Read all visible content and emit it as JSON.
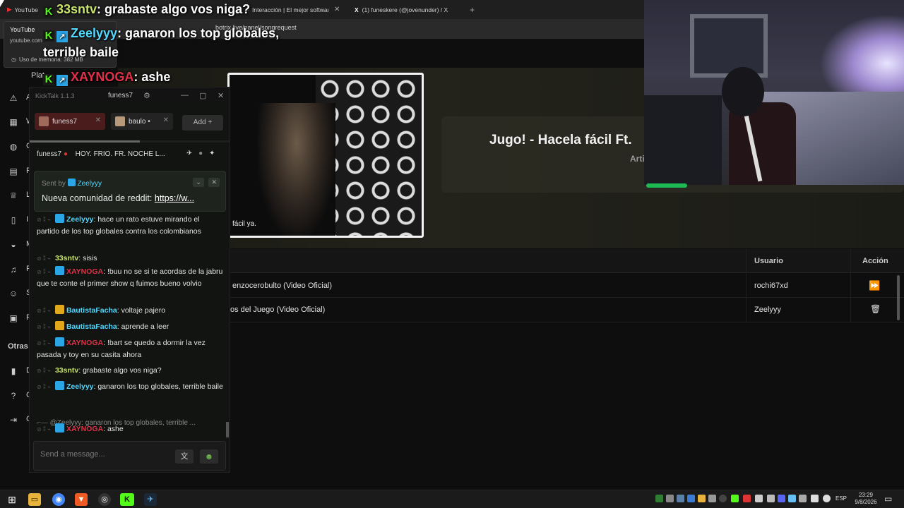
{
  "browser": {
    "tabs": [
      {
        "label": "YouTube"
      },
      {
        "label": "Interacción | El mejor software"
      },
      {
        "label": "(1) funeskere (@jovenunder) / X"
      }
    ],
    "new_tab": "+",
    "url": "botrix.live/panel/songrequest"
  },
  "tooltip": {
    "title": "YouTube",
    "domain": "youtube.com",
    "memory": "Uso de memoria: 382 MB"
  },
  "sidebar": {
    "items_tail": [
      "A",
      "W",
      "C",
      "R",
      "L",
      "I",
      "M",
      "R",
      "S",
      "F"
    ],
    "section": "Otras",
    "items_tail2": [
      "D",
      "C",
      "C"
    ],
    "plat_label": "Plat"
  },
  "overlay": {
    "line1_user": "33sntv",
    "line1_text": ": grabaste algo vos niga?",
    "line2_user": "Zeelyyy",
    "line2_text": ": ganaron los top globales,",
    "line2_cont": "terrible baile",
    "line3_user": "XAYNOGA",
    "line3_text": ": ashe"
  },
  "video": {
    "caption": "fácil ya."
  },
  "now_playing": {
    "title": "Jugo! - Hacela fácil Ft.",
    "artist": "Arti"
  },
  "queue": {
    "headers": {
      "user": "Usuario",
      "action": "Acción"
    },
    "rows": [
      {
        "title": "enzocerobulto (Video Oficial)",
        "user": "rochi67xd",
        "action_icon": "skip-forward-icon"
      },
      {
        "title": "os del Juego (Video Oficial)",
        "user": "Zeelyyy",
        "action_icon": "trash-icon"
      }
    ]
  },
  "kicktalk": {
    "app_name": "KickTalk 1.1.3",
    "user": "funess7",
    "tabs": [
      {
        "label": "funess7"
      },
      {
        "label": "baulo •"
      }
    ],
    "add_label": "Add +",
    "stream_channel": "funess7",
    "stream_title": "HOY. FRIO. FR. NOCHE L...",
    "pinned": {
      "sent_by_label": "Sent by",
      "sent_by_user": "Zeelyyy",
      "text": "Nueva comunidad de reddit: ",
      "link": "https://w..."
    },
    "messages": [
      {
        "user": "Zeelyyy",
        "color": "#53d8ff",
        "badge": "prime",
        "text": " hace un rato estuve mirando el partido de los top globales contra los colombianos"
      },
      {
        "user": "33sntv",
        "color": "#c9e26b",
        "badge": "none",
        "text": " sisis"
      },
      {
        "user": "XAYNOGA",
        "color": "#e0304a",
        "badge": "prime",
        "text": " !buu no se si te acordas de la jabru que te conte el primer show q fuimos bueno volvio"
      },
      {
        "user": "BautistaFacha",
        "color": "#53d8ff",
        "badge": "crown",
        "text": " voltaje pajero"
      },
      {
        "user": "BautistaFacha",
        "color": "#53d8ff",
        "badge": "crown",
        "text": " aprende a leer"
      },
      {
        "user": "XAYNOGA",
        "color": "#e0304a",
        "badge": "prime",
        "text": " !bart se quedo a dormir la vez pasada y toy en su casita ahora"
      },
      {
        "user": "33sntv",
        "color": "#c9e26b",
        "badge": "none",
        "text": " grabaste algo vos niga?"
      },
      {
        "user": "Zeelyyy",
        "color": "#53d8ff",
        "badge": "prime",
        "text": " ganaron los top globales, terrible baile"
      }
    ],
    "reply_preview": "@Zeelyyy: ganaron los top globales, terrible ...",
    "last_message": {
      "user": "XAYNOGA",
      "color": "#e0304a",
      "text": " ashe"
    },
    "input_placeholder": "Send a message..."
  },
  "taskbar": {
    "lang": "ESP",
    "time": "23:29",
    "date": "9/8/2026"
  },
  "colors": {
    "kick_green": "#53fc18",
    "spotify_green": "#1db954",
    "xaynoga_red": "#e0304a",
    "cyan_user": "#53d8ff"
  }
}
